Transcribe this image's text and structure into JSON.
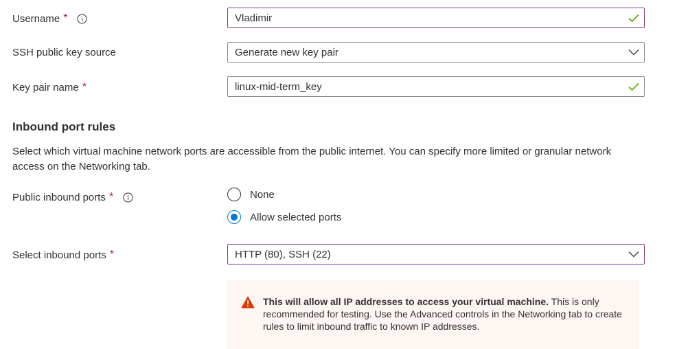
{
  "username": {
    "label": "Username",
    "required": "*",
    "value": "Vladimir"
  },
  "ssh_key_source": {
    "label": "SSH public key source",
    "value": "Generate new key pair"
  },
  "key_pair_name": {
    "label": "Key pair name",
    "required": "*",
    "value": "linux-mid-term_key"
  },
  "inbound_rules": {
    "title": "Inbound port rules",
    "description": "Select which virtual machine network ports are accessible from the public internet. You can specify more limited or granular network access on the Networking tab."
  },
  "public_inbound_ports": {
    "label": "Public inbound ports",
    "required": "*",
    "options": [
      {
        "label": "None",
        "checked": false
      },
      {
        "label": "Allow selected ports",
        "checked": true
      }
    ]
  },
  "select_inbound_ports": {
    "label": "Select inbound ports",
    "required": "*",
    "value": "HTTP (80), SSH (22)"
  },
  "warning": {
    "bold": "This will allow all IP addresses to access your virtual machine.",
    "text": " This is only recommended for testing.  Use the Advanced controls in the Networking tab to create rules to limit inbound traffic to known IP addresses."
  },
  "colors": {
    "required": "#a4262c",
    "check": "#57a300",
    "focus_border": "#7a3e9d",
    "radio_accent": "#0078d4",
    "warning_icon": "#d83b01",
    "warning_bg": "#fdf6f3"
  },
  "icons": {
    "info": "info-icon",
    "valid": "checkmark-icon",
    "dropdown": "chevron-down-icon",
    "warning": "warning-icon"
  }
}
